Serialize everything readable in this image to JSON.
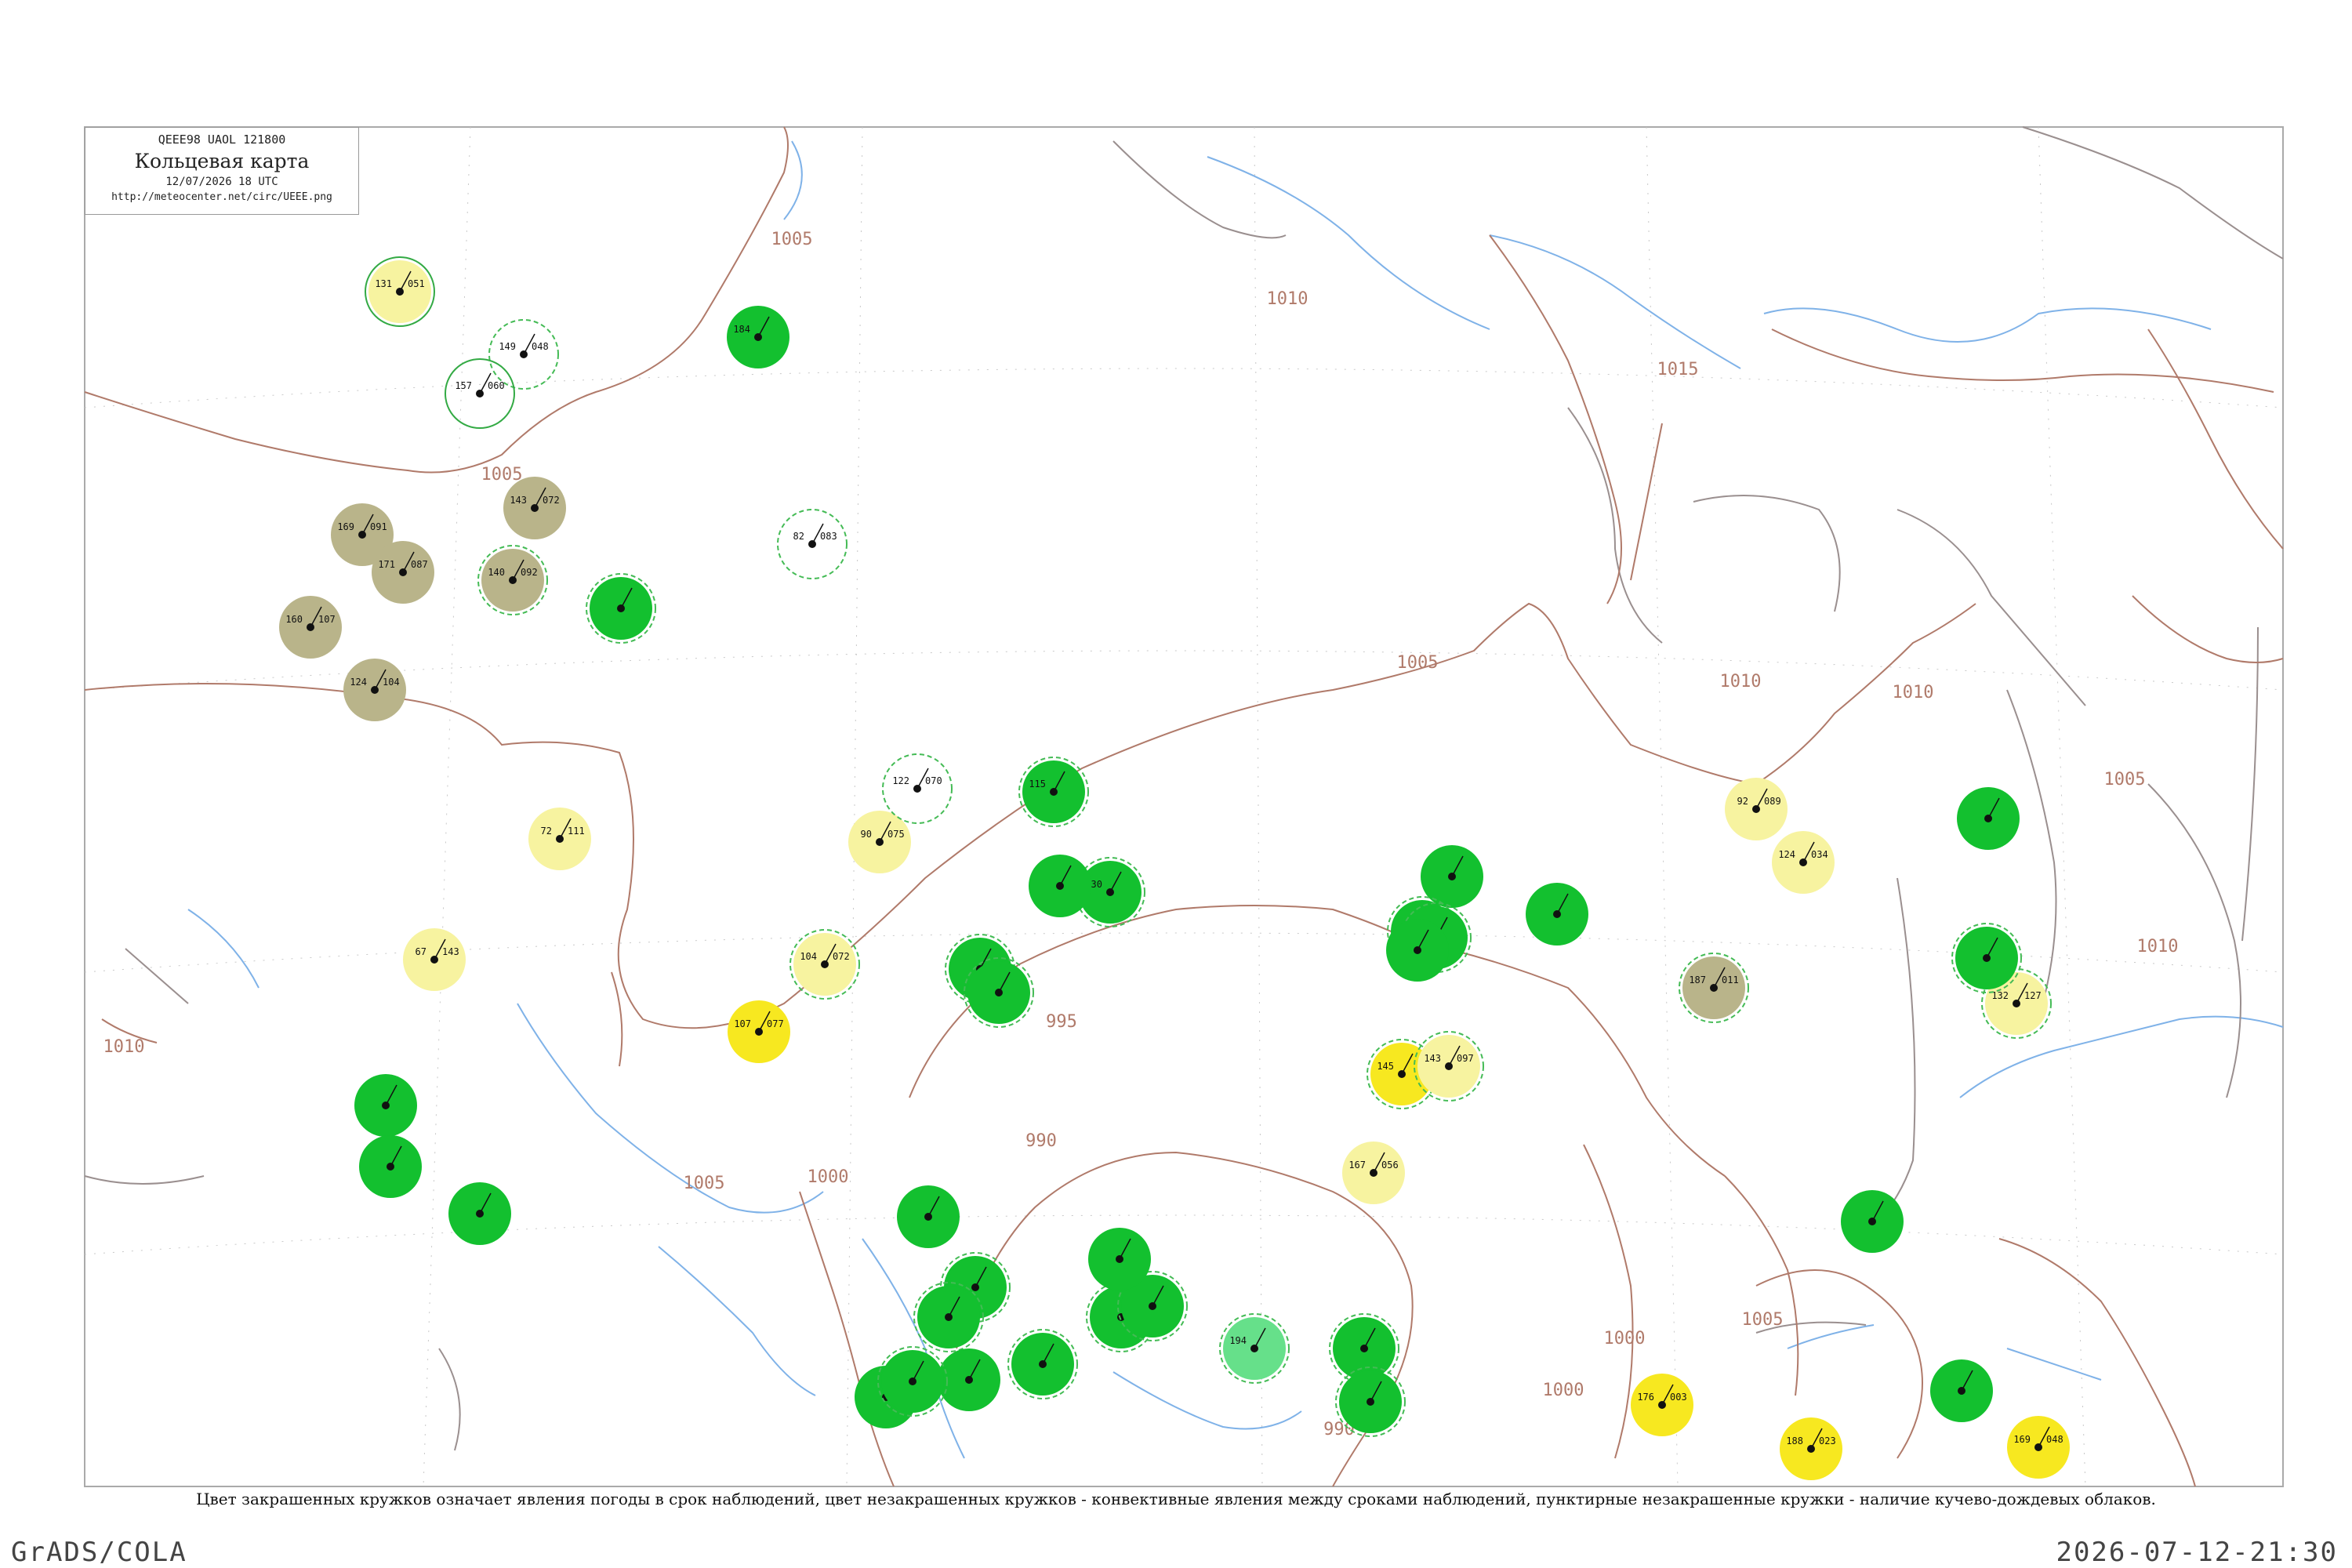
{
  "header": {
    "code_line": "QEEE98  UAOL  121800",
    "title": "Кольцевая карта",
    "time": "12/07/2026 18 UTC",
    "url": "http://meteocenter.net/circ/UEEE.png"
  },
  "isobar_labels": [
    "1005",
    "1010",
    "1015",
    "1005",
    "1010",
    "1005",
    "1010",
    "1005",
    "1010",
    "995",
    "990",
    "1000",
    "990",
    "1000",
    "1005",
    "1005",
    "1010",
    "1000"
  ],
  "stations": [
    {
      "t": "131",
      "p": "051",
      "fill": "#f7f3a0",
      "ring": "conv"
    },
    {
      "t": "149",
      "p": "048",
      "fill": "none",
      "ring": "cb"
    },
    {
      "t": "157",
      "p": "060",
      "fill": "none",
      "ring": "conv"
    },
    {
      "t": "184",
      "p": "",
      "fill": "#13c02f",
      "ring": "none"
    },
    {
      "t": "169",
      "p": "091",
      "fill": "#b9b48a",
      "ring": "none"
    },
    {
      "t": "171",
      "p": "087",
      "fill": "#b9b48a",
      "ring": "none"
    },
    {
      "t": "143",
      "p": "072",
      "fill": "#b9b48a",
      "ring": "none"
    },
    {
      "t": "140",
      "p": "092",
      "fill": "#b9b48a",
      "ring": "cb"
    },
    {
      "t": "160",
      "p": "107",
      "fill": "#b9b48a",
      "ring": "none"
    },
    {
      "t": "124",
      "p": "104",
      "fill": "#b9b48a",
      "ring": "none"
    },
    {
      "t": "",
      "p": "",
      "fill": "#13c02f",
      "ring": "cb"
    },
    {
      "t": "82",
      "p": "083",
      "fill": "none",
      "ring": "cb"
    },
    {
      "t": "72",
      "p": "111",
      "fill": "#f7f3a0",
      "ring": "none"
    },
    {
      "t": "90",
      "p": "075",
      "fill": "#f7f3a0",
      "ring": "none"
    },
    {
      "t": "122",
      "p": "070",
      "fill": "none",
      "ring": "cb"
    },
    {
      "t": "67",
      "p": "143",
      "fill": "#f7f3a0",
      "ring": "none"
    },
    {
      "t": "107",
      "p": "077",
      "fill": "#f7e820",
      "ring": "none"
    },
    {
      "t": "104",
      "p": "072",
      "fill": "#f7f3a0",
      "ring": "cb"
    },
    {
      "t": "115",
      "p": "",
      "fill": "#13c02f",
      "ring": "cb"
    },
    {
      "t": "130",
      "p": "",
      "fill": "#13c02f",
      "ring": "cb"
    },
    {
      "t": "",
      "p": "",
      "fill": "#13c02f",
      "ring": "cb"
    },
    {
      "t": "",
      "p": "",
      "fill": "#13c02f",
      "ring": "cb"
    },
    {
      "t": "",
      "p": "",
      "fill": "#13c02f",
      "ring": "none"
    },
    {
      "t": "",
      "p": "",
      "fill": "#13c02f",
      "ring": "none"
    },
    {
      "t": "",
      "p": "",
      "fill": "#13c02f",
      "ring": "none"
    },
    {
      "t": "",
      "p": "",
      "fill": "#13c02f",
      "ring": "none"
    },
    {
      "t": "",
      "p": "",
      "fill": "#13c02f",
      "ring": "cb"
    },
    {
      "t": "",
      "p": "",
      "fill": "#13c02f",
      "ring": "cb"
    },
    {
      "t": "",
      "p": "",
      "fill": "#13c02f",
      "ring": "cb"
    },
    {
      "t": "",
      "p": "",
      "fill": "#13c02f",
      "ring": "cb"
    },
    {
      "t": "",
      "p": "",
      "fill": "#13c02f",
      "ring": "cb"
    },
    {
      "t": "194",
      "p": "",
      "fill": "#66e08a",
      "ring": "cb"
    },
    {
      "t": "",
      "p": "",
      "fill": "#13c02f",
      "ring": "cb"
    },
    {
      "t": "",
      "p": "",
      "fill": "#13c02f",
      "ring": "cb"
    },
    {
      "t": "",
      "p": "",
      "fill": "#13c02f",
      "ring": "none"
    },
    {
      "t": "",
      "p": "",
      "fill": "#13c02f",
      "ring": "none"
    },
    {
      "t": "",
      "p": "",
      "fill": "#13c02f",
      "ring": "none"
    },
    {
      "t": "145",
      "p": "",
      "fill": "#f7e820",
      "ring": "cb"
    },
    {
      "t": "143",
      "p": "097",
      "fill": "#f7f3a0",
      "ring": "cb"
    },
    {
      "t": "167",
      "p": "056",
      "fill": "#f7f3a0",
      "ring": "none"
    },
    {
      "t": "92",
      "p": "089",
      "fill": "#f7f3a0",
      "ring": "none"
    },
    {
      "t": "124",
      "p": "034",
      "fill": "#f7f3a0",
      "ring": "none"
    },
    {
      "t": "187",
      "p": "011",
      "fill": "#b9b48a",
      "ring": "cb"
    },
    {
      "t": "132",
      "p": "127",
      "fill": "#f7f3a0",
      "ring": "cb"
    },
    {
      "t": "176",
      "p": "003",
      "fill": "#f7e820",
      "ring": "none"
    },
    {
      "t": "188",
      "p": "023",
      "fill": "#f7e820",
      "ring": "none"
    },
    {
      "t": "169",
      "p": "048",
      "fill": "#f7e820",
      "ring": "none"
    },
    {
      "t": "",
      "p": "",
      "fill": "#13c02f",
      "ring": "none"
    },
    {
      "t": "",
      "p": "",
      "fill": "#13c02f",
      "ring": "cb"
    },
    {
      "t": "",
      "p": "",
      "fill": "#13c02f",
      "ring": "cb"
    },
    {
      "t": "",
      "p": "",
      "fill": "#13c02f",
      "ring": "none"
    },
    {
      "t": "",
      "p": "",
      "fill": "#13c02f",
      "ring": "none"
    },
    {
      "t": "",
      "p": "",
      "fill": "#13c02f",
      "ring": "none"
    },
    {
      "t": "",
      "p": "",
      "fill": "#13c02f",
      "ring": "none"
    },
    {
      "t": "",
      "p": "",
      "fill": "#13c02f",
      "ring": "none"
    },
    {
      "t": "",
      "p": "",
      "fill": "#13c02f",
      "ring": "cb"
    },
    {
      "t": "",
      "p": "",
      "fill": "#13c02f",
      "ring": "none"
    },
    {
      "t": "",
      "p": "",
      "fill": "#13c02f",
      "ring": "cb"
    }
  ],
  "caption": "Цвет закрашенных кружков означает явления погоды в срок наблюдений, цвет незакрашенных кружков - конвективные явления между сроками наблюдений, пунктирные незакрашенные кружки - наличие кучево-дождевых облаков.",
  "footer": {
    "left": "GrADS/COLA",
    "right": "2026-07-12-21:30"
  },
  "colors": {
    "isobar": "#b07a6a",
    "river": "#7fb2e8",
    "border": "#9a8f8f",
    "cb_ring": "#44bb55",
    "conv_ring": "#33aa44"
  }
}
